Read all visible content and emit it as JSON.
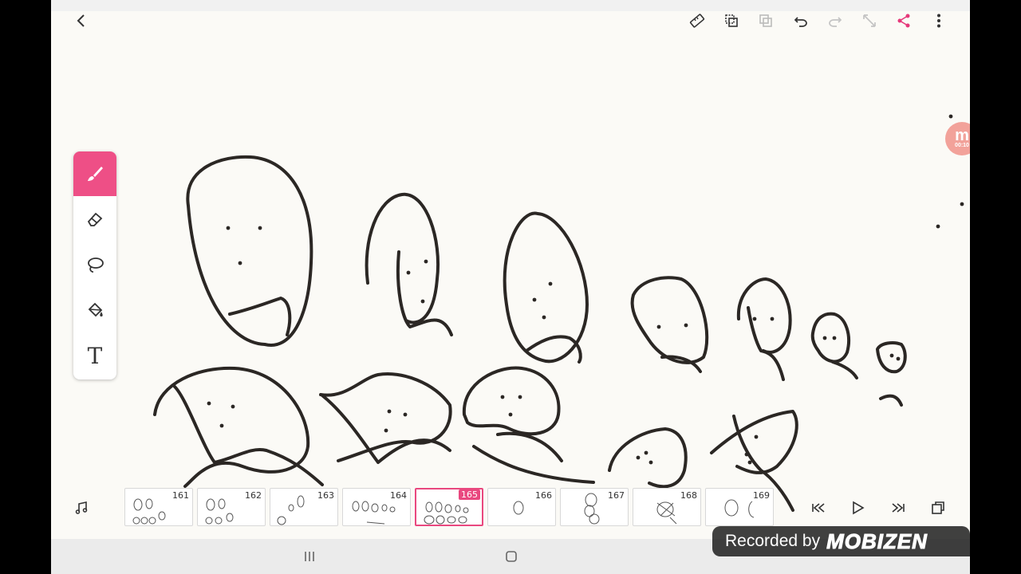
{
  "app": {
    "name": "drawing-animation-app"
  },
  "toolbar_right": {
    "icons": [
      "ruler-icon",
      "copy-frame-icon",
      "paste-frame-icon",
      "undo-icon",
      "redo-icon",
      "expand-icon",
      "share-icon",
      "more-icon"
    ]
  },
  "tools": {
    "items": [
      "brush",
      "eraser",
      "lasso",
      "fill",
      "text"
    ],
    "active": "brush",
    "text_tool_label": "T"
  },
  "timeline": {
    "frames": [
      {
        "number": "161"
      },
      {
        "number": "162"
      },
      {
        "number": "163"
      },
      {
        "number": "164"
      },
      {
        "number": "165"
      },
      {
        "number": "166"
      },
      {
        "number": "167"
      },
      {
        "number": "168"
      },
      {
        "number": "169"
      }
    ],
    "active_frame": "165"
  },
  "overlay": {
    "recorded_label": "Recorded by",
    "brand": "MOBIZEN",
    "bubble_letter": "m",
    "bubble_time": "00:10"
  },
  "colors": {
    "accent": "#ee4f86",
    "canvas": "#fbfaf6",
    "ink": "#2b2724"
  }
}
